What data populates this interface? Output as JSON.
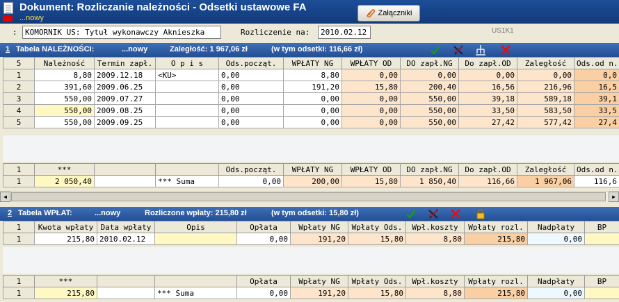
{
  "window": {
    "title": "Dokument: Rozliczanie należności - Odsetki ustawowe FA",
    "subtitle": "...nowy",
    "attachments_label": "Załączniki"
  },
  "info": {
    "colon": ":",
    "komornik": "KOMORNIK US: Tytuł wykonawczy Aknieszka",
    "rozliczenie_label": "Rozliczenie na:",
    "rozliczenie_date": "2010.02.12",
    "code": "US1K1"
  },
  "nal": {
    "num": "1",
    "title": "Tabela NALEŻNOŚCI:",
    "state": "...nowy",
    "zaleglosc": "Zaległość: 1 967,06 zł",
    "odsetki": "(w tym odsetki: 116,66 zł)",
    "count": "5",
    "headers": [
      "Należność",
      "Termin zapł.",
      "O p i s",
      "Ods.począt.",
      "WPŁATY NG",
      "WPŁATY OD",
      "DO zapł.NG",
      "Do zapł.OD",
      "Zaległość",
      "Ods.od n."
    ],
    "rows": [
      {
        "idx": "1",
        "cells": [
          "8,80",
          "2009.12.18",
          "<KU>",
          "0,00",
          "8,80",
          "0,00",
          "0,00",
          "0,00",
          "0,00",
          "0,0"
        ]
      },
      {
        "idx": "2",
        "cells": [
          "391,60",
          "2009.06.25",
          "",
          "0,00",
          "191,20",
          "15,80",
          "200,40",
          "16,56",
          "216,96",
          "16,5"
        ]
      },
      {
        "idx": "3",
        "cells": [
          "550,00",
          "2009.07.27",
          "",
          "0,00",
          "0,00",
          "0,00",
          "550,00",
          "39,18",
          "589,18",
          "39,1"
        ]
      },
      {
        "idx": "4",
        "cells": [
          "550,00",
          "2009.08.25",
          "",
          "0,00",
          "0,00",
          "0,00",
          "550,00",
          "33,50",
          "583,50",
          "33,5"
        ]
      },
      {
        "idx": "5",
        "cells": [
          "550,00",
          "2009.09.25",
          "",
          "0,00",
          "0,00",
          "0,00",
          "550,00",
          "27,42",
          "577,42",
          "27,4"
        ]
      }
    ],
    "sum_header": {
      "idx": "1",
      "cells": [
        "***",
        "",
        "",
        "Ods.począt.",
        "WPŁATY NG",
        "WPŁATY OD",
        "DO zapł.NG",
        "Do zapł.OD",
        "Zaległość",
        "Ods.od n."
      ]
    },
    "sum_row": {
      "idx": "1",
      "cells": [
        "2 050,40",
        "",
        "*** Suma",
        "0,00",
        "200,00",
        "15,80",
        "1 850,40",
        "116,66",
        "1 967,06",
        "116,6"
      ]
    }
  },
  "wpl": {
    "num": "2",
    "title": "Tabela WPŁAT:",
    "state": "...nowy",
    "rozliczone": "Rozliczone wpłaty: 215,80 zł",
    "odsetki": "(w tym odsetki: 15,80 zł)",
    "count": "1",
    "headers": [
      "Kwota wpłaty",
      "Data wpłaty",
      "Opis",
      "Opłata",
      "Wpłaty  NG",
      "Wpłaty Ods.",
      "Wpł.koszty",
      "Wpłaty rozl.",
      "Nadpłaty",
      "BP"
    ],
    "rows": [
      {
        "idx": "1",
        "cells": [
          "215,80",
          "2010.02.12",
          "",
          "0,00",
          "191,20",
          "15,80",
          "8,80",
          "215,80",
          "0,00",
          ""
        ]
      }
    ],
    "sum_header": {
      "idx": "1",
      "cells": [
        "***",
        "",
        "",
        "Opłata",
        "Wpłaty  NG",
        "Wpłaty Ods.",
        "Wpł.koszty",
        "Wpłaty rozl.",
        "Nadpłaty",
        "BP"
      ]
    },
    "sum_row": {
      "idx": "1",
      "cells": [
        "215,80",
        "",
        "*** Suma",
        "0,00",
        "191,20",
        "15,80",
        "8,80",
        "215,80",
        "0,00",
        ""
      ]
    }
  },
  "colors": {
    "peach": "#fde5cc",
    "orange": "#f9cfa3",
    "yellow": "#fff8c2",
    "header_blue": "#234f94",
    "ok_green": "#10a010",
    "del_red": "#e01010"
  },
  "icons": [
    "document-icon",
    "paperclip-icon",
    "accept-icon",
    "cancel-edit-icon",
    "split-icon",
    "delete-icon",
    "lock-icon"
  ]
}
